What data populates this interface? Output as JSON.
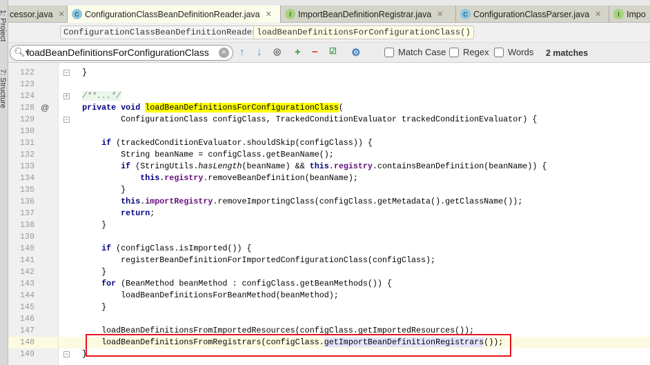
{
  "tool_strip": {
    "project": "1: Project",
    "structure": "7: Structure"
  },
  "tabs": [
    {
      "label": "cessor.java",
      "icon": "",
      "active": false
    },
    {
      "label": "ConfigurationClassBeanDefinitionReader.java",
      "icon": "class",
      "active": true
    },
    {
      "label": "ImportBeanDefinitionRegistrar.java",
      "icon": "interface",
      "active": false
    },
    {
      "label": "ConfigurationClassParser.java",
      "icon": "class",
      "active": false
    },
    {
      "label": "Impo",
      "icon": "interface",
      "active": false
    }
  ],
  "breadcrumbs": [
    "ConfigurationClassBeanDefinitionReader",
    "loadBeanDefinitionsForConfigurationClass()"
  ],
  "search": {
    "value": "loadBeanDefinitionsForConfigurationClass",
    "match_case": "Match Case",
    "regex": "Regex",
    "words": "Words",
    "matches": "2 matches",
    "match_case_checked": false,
    "regex_checked": false,
    "words_checked": false
  },
  "colors": {
    "highlight": "#ffff00",
    "keyword": "#000080",
    "field": "#660e7a",
    "annotation_box": "#e5141c"
  },
  "lines": [
    {
      "n": "122",
      "seg": [
        [
          "    }",
          ""
        ]
      ]
    },
    {
      "n": "123",
      "seg": []
    },
    {
      "n": "124",
      "seg": [
        [
          "    ",
          ""
        ],
        [
          "/**...*/",
          "cmt"
        ]
      ]
    },
    {
      "n": "128",
      "mark": "@",
      "seg": [
        [
          "    ",
          ""
        ],
        [
          "private void ",
          "kw"
        ],
        [
          "loadBeanDefinitionsForConfigurationClass",
          "hl"
        ],
        [
          "(",
          ""
        ]
      ]
    },
    {
      "n": "129",
      "seg": [
        [
          "            ConfigurationClass configClass, TrackedConditionEvaluator trackedConditionEvaluator) {",
          ""
        ]
      ]
    },
    {
      "n": "130",
      "seg": []
    },
    {
      "n": "131",
      "seg": [
        [
          "        ",
          ""
        ],
        [
          "if ",
          "kw"
        ],
        [
          "(trackedConditionEvaluator.shouldSkip(configClass)) {",
          ""
        ]
      ]
    },
    {
      "n": "132",
      "seg": [
        [
          "            String beanName = configClass.getBeanName();",
          ""
        ]
      ]
    },
    {
      "n": "133",
      "seg": [
        [
          "            ",
          ""
        ],
        [
          "if ",
          "kw"
        ],
        [
          "(StringUtils.",
          ""
        ],
        [
          "hasLength",
          "it"
        ],
        [
          "(beanName) && ",
          ""
        ],
        [
          "this",
          "kw"
        ],
        [
          ".",
          ""
        ],
        [
          "registry",
          "fld"
        ],
        [
          ".containsBeanDefinition(beanName)) {",
          ""
        ]
      ]
    },
    {
      "n": "134",
      "seg": [
        [
          "                ",
          ""
        ],
        [
          "this",
          "kw"
        ],
        [
          ".",
          ""
        ],
        [
          "registry",
          "fld"
        ],
        [
          ".removeBeanDefinition(beanName);",
          ""
        ]
      ]
    },
    {
      "n": "135",
      "seg": [
        [
          "            }",
          ""
        ]
      ]
    },
    {
      "n": "136",
      "seg": [
        [
          "            ",
          ""
        ],
        [
          "this",
          "kw"
        ],
        [
          ".",
          ""
        ],
        [
          "importRegistry",
          "fld"
        ],
        [
          ".removeImportingClass(configClass.getMetadata().getClassName());",
          ""
        ]
      ]
    },
    {
      "n": "137",
      "seg": [
        [
          "            ",
          ""
        ],
        [
          "return",
          "kw"
        ],
        [
          ";",
          ""
        ]
      ]
    },
    {
      "n": "138",
      "seg": [
        [
          "        }",
          ""
        ]
      ]
    },
    {
      "n": "139",
      "seg": []
    },
    {
      "n": "140",
      "seg": [
        [
          "        ",
          ""
        ],
        [
          "if ",
          "kw"
        ],
        [
          "(configClass.isImported()) {",
          ""
        ]
      ]
    },
    {
      "n": "141",
      "seg": [
        [
          "            registerBeanDefinitionForImportedConfigurationClass(configClass);",
          ""
        ]
      ]
    },
    {
      "n": "142",
      "seg": [
        [
          "        }",
          ""
        ]
      ]
    },
    {
      "n": "143",
      "seg": [
        [
          "        ",
          ""
        ],
        [
          "for ",
          "kw"
        ],
        [
          "(BeanMethod beanMethod : configClass.getBeanMethods()) {",
          ""
        ]
      ]
    },
    {
      "n": "144",
      "seg": [
        [
          "            loadBeanDefinitionsForBeanMethod(beanMethod);",
          ""
        ]
      ]
    },
    {
      "n": "145",
      "seg": [
        [
          "        }",
          ""
        ]
      ]
    },
    {
      "n": "146",
      "seg": []
    },
    {
      "n": "147",
      "seg": [
        [
          "        loadBeanDefinitionsFromImportedResources(configClass.getImportedResources());",
          ""
        ]
      ]
    },
    {
      "n": "148",
      "current": true,
      "bulb": true,
      "seg": [
        [
          "        loadBeanDefinitionsFromRegistrars(configClass.",
          ""
        ],
        [
          "getImportBeanDefinitionRegistrars",
          "sel"
        ],
        [
          "());",
          ""
        ]
      ]
    },
    {
      "n": "149",
      "seg": [
        [
          "    }",
          ""
        ]
      ]
    }
  ]
}
